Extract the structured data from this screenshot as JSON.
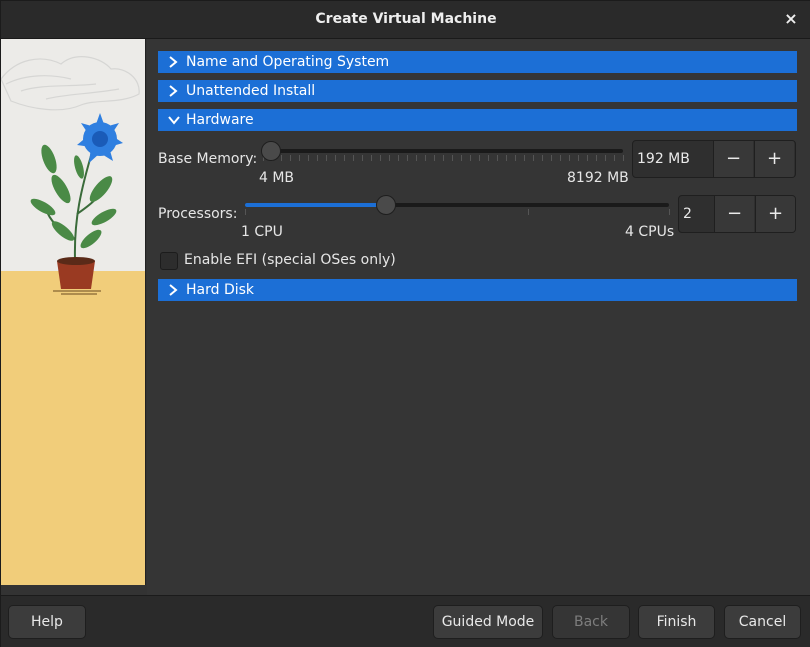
{
  "window": {
    "title": "Create Virtual Machine",
    "close_icon": "×"
  },
  "sections": {
    "name_os": "Name and Operating System",
    "unattended": "Unattended Install",
    "hardware": "Hardware",
    "hard_disk": "Hard Disk"
  },
  "memory": {
    "label": "Base Memory:",
    "min_label": "4 MB",
    "max_label": "8192 MB",
    "value": "192 MB",
    "position": 0.023
  },
  "processors": {
    "label": "Processors:",
    "min_label": "1 CPU",
    "max_label": "4 CPUs",
    "value": "2",
    "position": 0.333
  },
  "spin_buttons": {
    "minus": "−",
    "plus": "+"
  },
  "efi": {
    "label": "Enable EFI (special OSes only)",
    "checked": false
  },
  "footer": {
    "help": "Help",
    "guided_mode": "Guided Mode",
    "back": "Back",
    "finish": "Finish",
    "cancel": "Cancel"
  },
  "colors": {
    "accent": "#1c6fd6",
    "background": "#353535"
  }
}
